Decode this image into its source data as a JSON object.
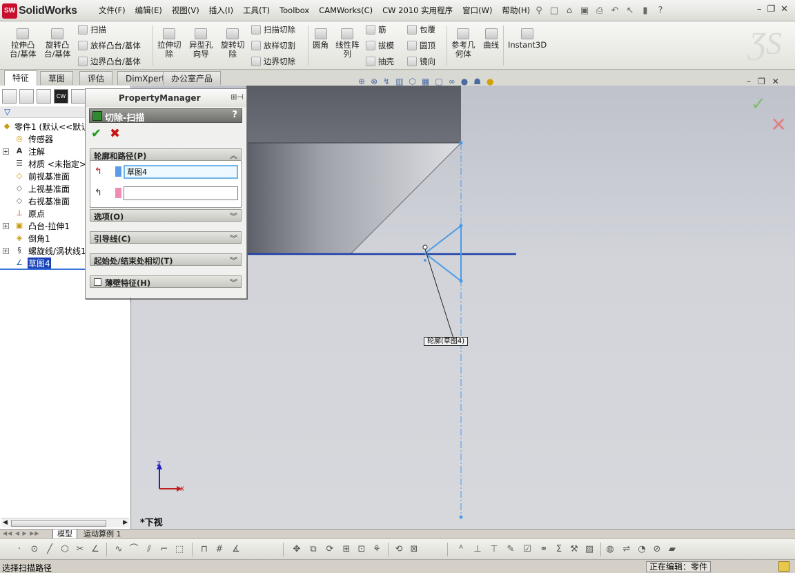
{
  "app": {
    "logo_mark": "SW",
    "logo_text": "SolidWorks"
  },
  "menus": [
    "文件(F)",
    "编辑(E)",
    "视图(V)",
    "插入(I)",
    "工具(T)",
    "Toolbox",
    "CAMWorks(C)",
    "CW 2010 实用程序",
    "窗口(W)",
    "帮助(H)"
  ],
  "ribbon": {
    "extrude_boss": "拉伸凸\n台/基体",
    "revolve_boss": "旋转凸\n台/基体",
    "sweep": "扫描",
    "loft_boss": "放样凸台/基体",
    "boundary_boss": "边界凸台/基体",
    "extrude_cut": "拉伸切\n除",
    "hole_wizard": "异型孔\n向导",
    "revolve_cut": "旋转切\n除",
    "sweep_cut": "扫描切除",
    "loft_cut": "放样切割",
    "boundary_cut": "边界切除",
    "fillet": "圆角",
    "linear_pattern": "线性阵\n列",
    "rib": "筋",
    "draft": "拔模",
    "shell": "抽壳",
    "wrap": "包覆",
    "dome": "圆顶",
    "mirror": "镜向",
    "ref_geometry": "参考几\n何体",
    "curves": "曲线",
    "instant3d": "Instant3D"
  },
  "tabs": [
    "特征",
    "草图",
    "评估",
    "DimXpert",
    "办公室产品"
  ],
  "feature_tree": [
    {
      "label": "零件1 (默认<<默认",
      "icon": "part-icon",
      "expandable": false,
      "level": 0
    },
    {
      "label": "传感器",
      "icon": "sensor-icon",
      "expandable": false,
      "level": 1
    },
    {
      "label": "注解",
      "icon": "annotation-icon",
      "expandable": true,
      "level": 1
    },
    {
      "label": "材质 <未指定>",
      "icon": "material-icon",
      "expandable": false,
      "level": 1
    },
    {
      "label": "前视基准面",
      "icon": "plane-icon",
      "expandable": false,
      "level": 1
    },
    {
      "label": "上视基准面",
      "icon": "plane-icon",
      "expandable": false,
      "level": 1
    },
    {
      "label": "右视基准面",
      "icon": "plane-icon",
      "expandable": false,
      "level": 1
    },
    {
      "label": "原点",
      "icon": "origin-icon",
      "expandable": false,
      "level": 1
    },
    {
      "label": "凸台-拉伸1",
      "icon": "extrude-icon",
      "expandable": true,
      "level": 1
    },
    {
      "label": "倒角1",
      "icon": "chamfer-icon",
      "expandable": false,
      "level": 1
    },
    {
      "label": "螺旋线/涡状线1",
      "icon": "helix-icon",
      "expandable": true,
      "level": 1
    },
    {
      "label": "草图4",
      "icon": "sketch-icon",
      "expandable": false,
      "level": 1,
      "selected": true
    }
  ],
  "property_manager": {
    "title": "PropertyManager",
    "feature_name": "切除-扫描",
    "help": "?",
    "groups": {
      "profile_path": "轮廓和路径(P)",
      "options": "选项(O)",
      "guide_curves": "引导线(C)",
      "tangency": "起始处/结束处相切(T)",
      "thin_feature": "薄壁特征(H)"
    },
    "profile_value": "草图4",
    "path_value": "",
    "profile_color": "#5b9be8",
    "path_color": "#f08cb4"
  },
  "graphics": {
    "view_name": "*下视",
    "callout": "轮廓(草图4)",
    "axis_x": "X",
    "axis_z": "Z"
  },
  "bottom_tabs": [
    "模型",
    "运动算例 1"
  ],
  "status": {
    "left": "选择扫描路径",
    "right": "正在编辑：零件"
  }
}
